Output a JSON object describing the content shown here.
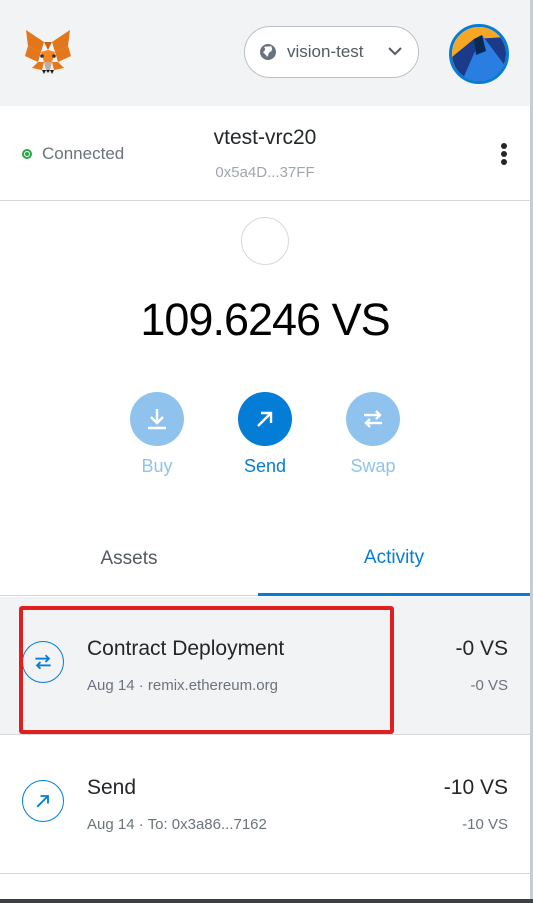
{
  "header": {
    "network_name": "vision-test",
    "logo_icon": "metamask-fox-icon",
    "network_icon": "globe-icon"
  },
  "account": {
    "status": "Connected",
    "name": "vtest-vrc20",
    "address": "0x5a4D...37FF"
  },
  "balance": {
    "amount": "109.6246 VS"
  },
  "actions": [
    {
      "label": "Buy",
      "icon": "download-icon"
    },
    {
      "label": "Send",
      "icon": "arrow-up-right-icon"
    },
    {
      "label": "Swap",
      "icon": "swap-arrows-icon"
    }
  ],
  "tabs": {
    "assets": "Assets",
    "activity": "Activity",
    "active": "activity"
  },
  "transactions": [
    {
      "title": "Contract Deployment",
      "subtitle": "Aug 14 · remix.ethereum.org",
      "amount": "-0 VS",
      "amount_secondary": "-0 VS",
      "icon": "swap-arrows-icon"
    },
    {
      "title": "Send",
      "subtitle": "Aug 14 · To: 0x3a86...7162",
      "amount": "-10 VS",
      "amount_secondary": "-10 VS",
      "icon": "arrow-up-right-icon"
    }
  ],
  "colors": {
    "accent": "#037dd6",
    "accent_light": "#8fc3ee",
    "connected": "#28a745",
    "highlight": "#e02020"
  }
}
